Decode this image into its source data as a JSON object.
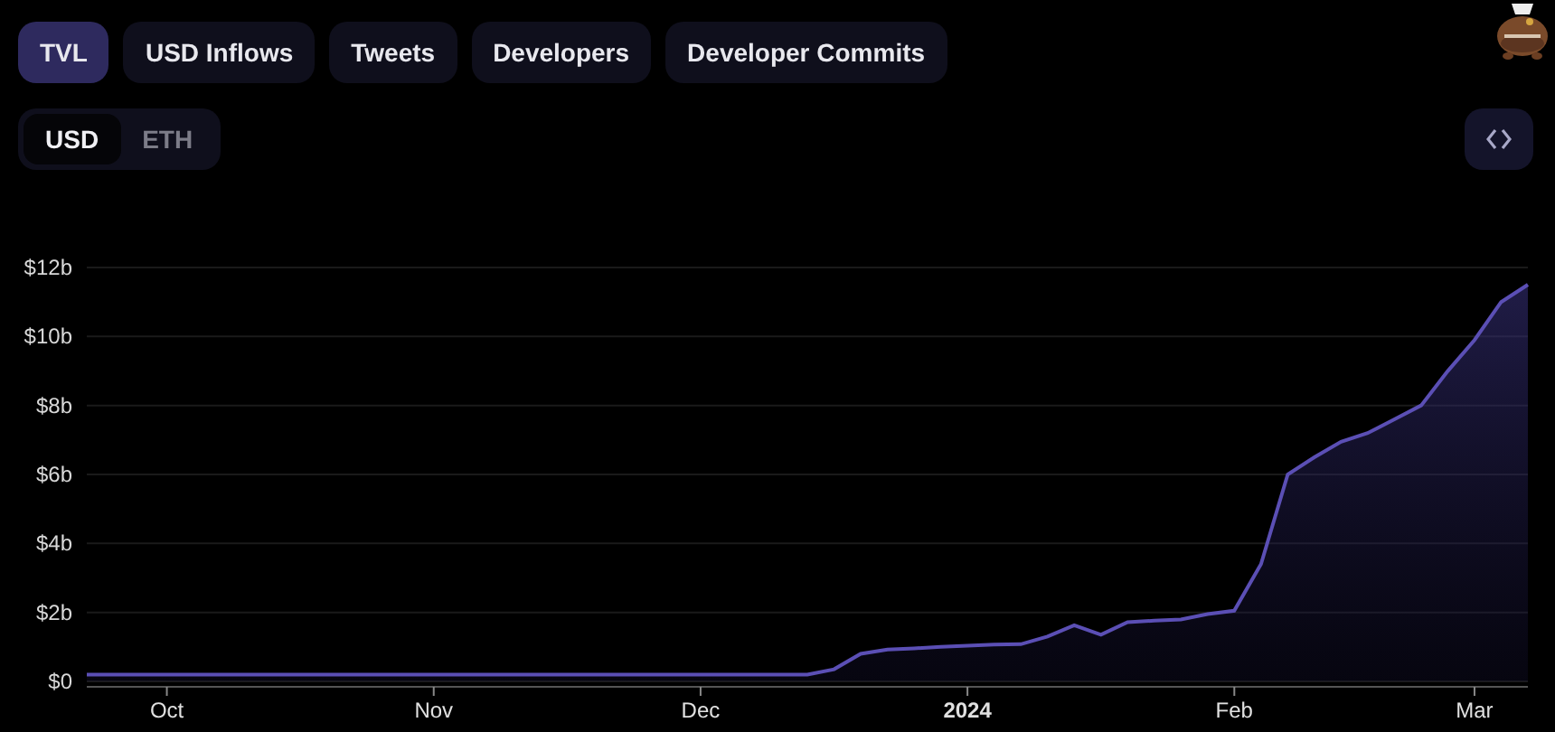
{
  "tabs": [
    {
      "label": "TVL",
      "selected": true
    },
    {
      "label": "USD Inflows",
      "selected": false
    },
    {
      "label": "Tweets",
      "selected": false
    },
    {
      "label": "Developers",
      "selected": false
    },
    {
      "label": "Developer Commits",
      "selected": false
    }
  ],
  "currency_toggle": [
    {
      "label": "USD",
      "selected": true
    },
    {
      "label": "ETH",
      "selected": false
    }
  ],
  "chart": {
    "chart_data": {
      "type": "area",
      "categories": [
        null,
        null,
        null,
        "Oct",
        null,
        null,
        null,
        null,
        null,
        null,
        null,
        null,
        null,
        "Nov",
        null,
        null,
        null,
        null,
        null,
        null,
        null,
        null,
        null,
        "Dec",
        null,
        null,
        null,
        null,
        null,
        null,
        null,
        null,
        null,
        "2024",
        null,
        null,
        null,
        null,
        null,
        null,
        null,
        null,
        null,
        "Feb",
        null,
        null,
        null,
        null,
        null,
        null,
        null,
        null,
        "Mar",
        null,
        null
      ],
      "series": [
        {
          "color": "#5b4fb5",
          "values": [
            0.2,
            0.2,
            0.2,
            0.2,
            0.2,
            0.2,
            0.2,
            0.2,
            0.2,
            0.2,
            0.2,
            0.2,
            0.2,
            0.2,
            0.2,
            0.2,
            0.2,
            0.2,
            0.2,
            0.2,
            0.2,
            0.2,
            0.2,
            0.2,
            0.2,
            0.2,
            0.2,
            0.2,
            0.35,
            0.8,
            0.92,
            0.96,
            1.0,
            1.03,
            1.07,
            1.08,
            1.3,
            1.63,
            1.35,
            1.72,
            1.76,
            1.8,
            1.95,
            2.05,
            3.4,
            6.0,
            6.5,
            6.95,
            7.2,
            7.6,
            8.0,
            9.0,
            9.9,
            11.0,
            11.5
          ]
        }
      ],
      "ylim": [
        0,
        12
      ],
      "grid": true,
      "yticks": [
        {
          "value": 0,
          "label": "$0"
        },
        {
          "value": 2,
          "label": "$2b"
        },
        {
          "value": 4,
          "label": "$4b"
        },
        {
          "value": 6,
          "label": "$6b"
        },
        {
          "value": 8,
          "label": "$8b"
        },
        {
          "value": 10,
          "label": "$10b"
        },
        {
          "value": 12,
          "label": "$12b"
        }
      ]
    }
  }
}
